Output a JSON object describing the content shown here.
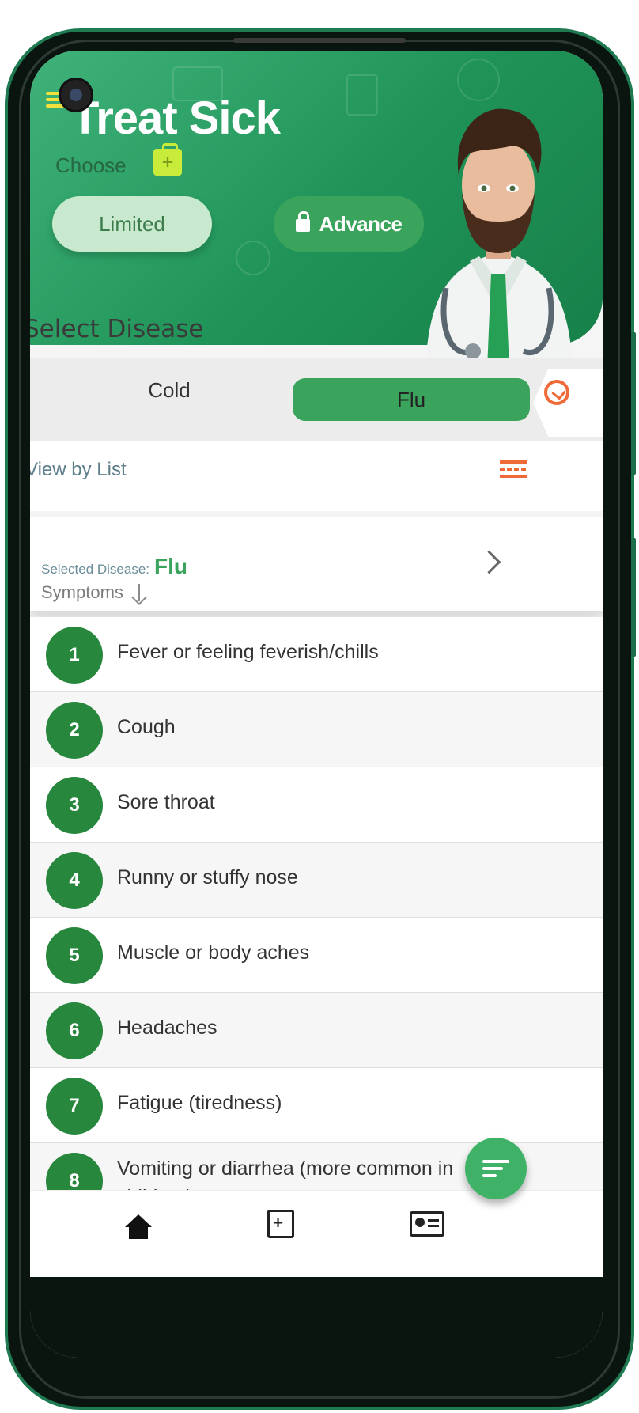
{
  "app": {
    "title": "Treat Sick",
    "choose_label": "Choose"
  },
  "modes": {
    "limited": "Limited",
    "advance": "Advance"
  },
  "disease_section": {
    "title": "Select Disease",
    "tabs": [
      "Cold",
      "Flu"
    ],
    "active_tab": "Flu"
  },
  "view": {
    "label": "View by List"
  },
  "selected": {
    "label": "Selected Disease:",
    "value": "Flu",
    "symptoms_label": "Symptoms"
  },
  "symptoms": [
    {
      "num": "1",
      "text": "Fever or feeling feverish/chills"
    },
    {
      "num": "2",
      "text": "Cough"
    },
    {
      "num": "3",
      "text": "Sore throat"
    },
    {
      "num": "4",
      "text": "Runny or stuffy nose"
    },
    {
      "num": "5",
      "text": "Muscle or body aches"
    },
    {
      "num": "6",
      "text": "Headaches"
    },
    {
      "num": "7",
      "text": "Fatigue (tiredness)"
    },
    {
      "num": "8",
      "text": "Vomiting or diarrhea (more common in children)"
    }
  ],
  "colors": {
    "primary_green": "#3ba45c",
    "dark_green": "#27873d",
    "accent_orange": "#ef6a36"
  },
  "nav": {
    "items": [
      "home-icon",
      "medical-kit-icon",
      "id-card-icon"
    ]
  }
}
